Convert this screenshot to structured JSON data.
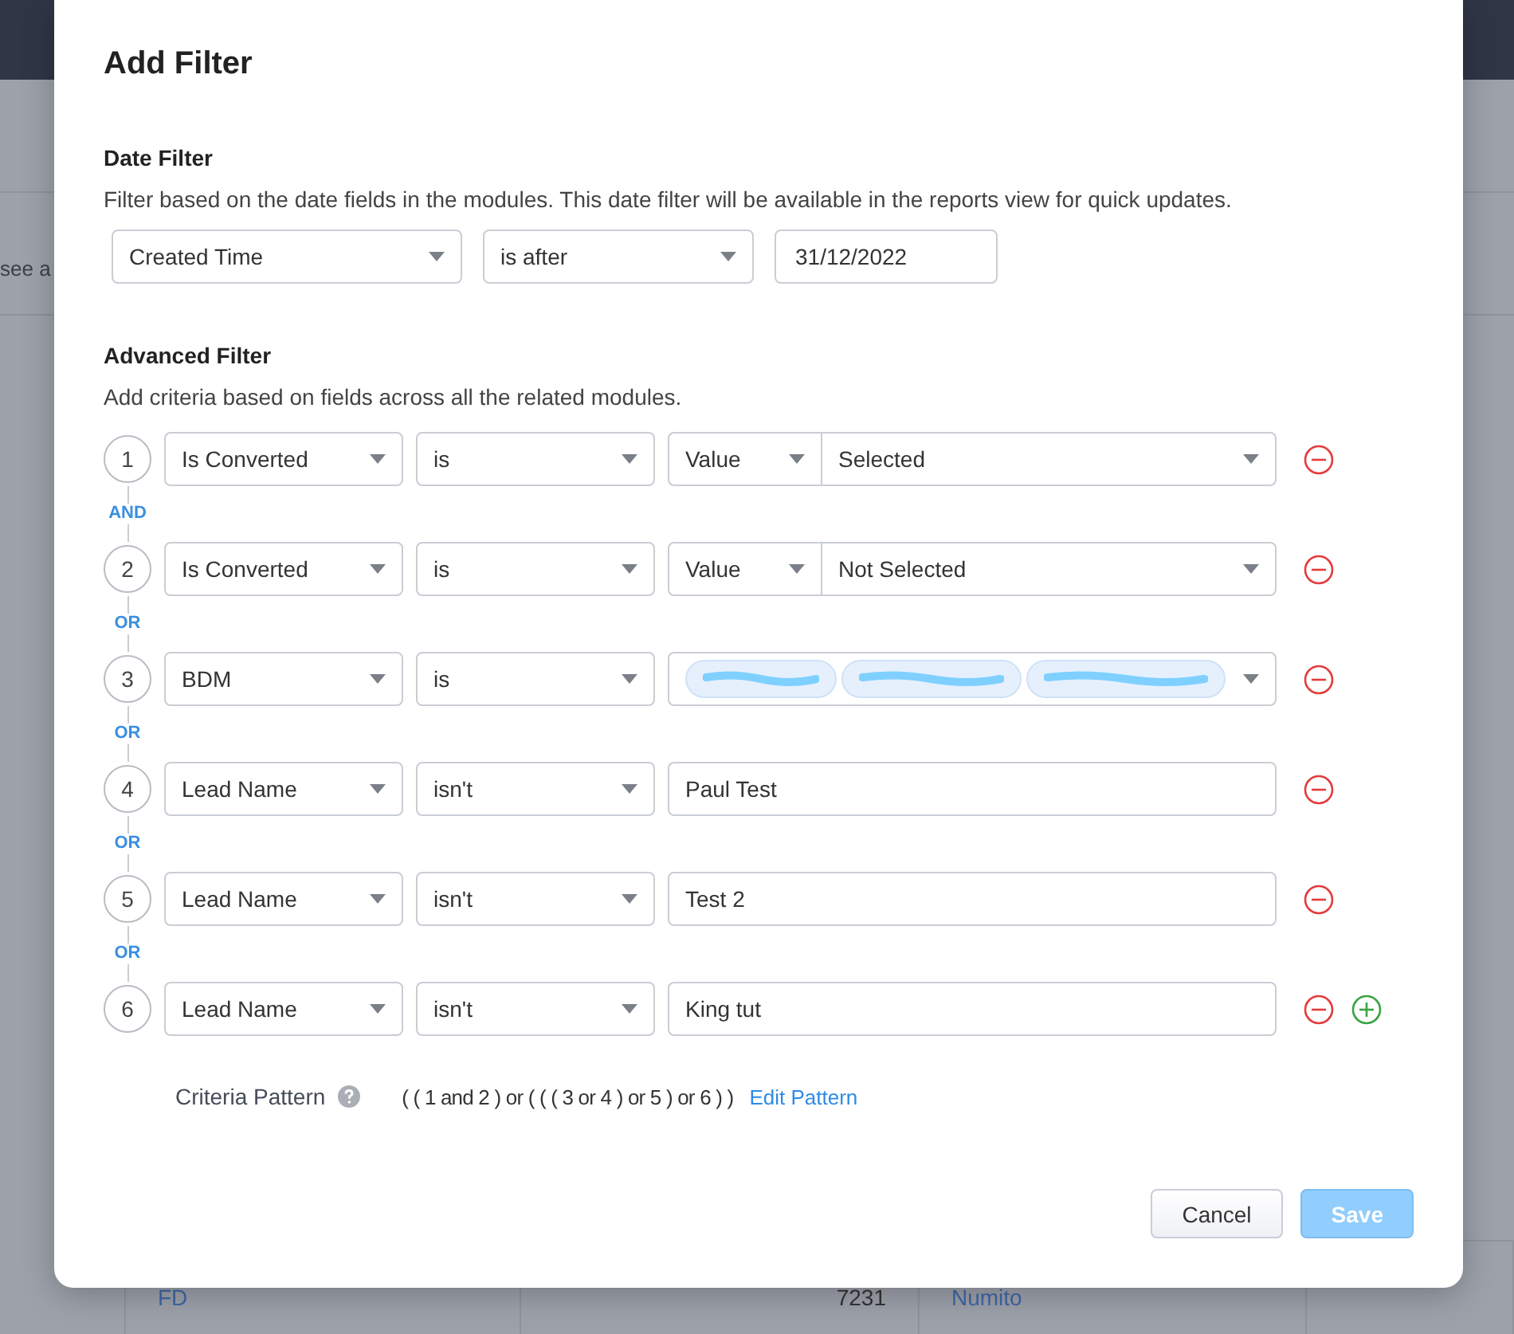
{
  "background": {
    "snippet": "see a",
    "table_cells": [
      "FD",
      "7231",
      "Numito"
    ]
  },
  "dialog": {
    "title": "Add Filter",
    "date_filter": {
      "heading": "Date Filter",
      "description": "Filter based on the date fields in the modules. This date filter will be available in the reports view for quick updates.",
      "field": "Created Time",
      "operator": "is after",
      "date": "31/12/2022"
    },
    "advanced_filter": {
      "heading": "Advanced Filter",
      "description": "Add criteria based on fields across all the related modules.",
      "criteria": [
        {
          "number": "1",
          "field": "Is Converted",
          "operator": "is",
          "value": {
            "kind": "value_select",
            "type": "Value",
            "selection": "Selected"
          },
          "connector": "AND",
          "can_add": false
        },
        {
          "number": "2",
          "field": "Is Converted",
          "operator": "is",
          "value": {
            "kind": "value_select",
            "type": "Value",
            "selection": "Not Selected"
          },
          "connector": "OR",
          "can_add": false
        },
        {
          "number": "3",
          "field": "BDM",
          "operator": "is",
          "value": {
            "kind": "tags",
            "tags": [
              {
                "kind": "redacted"
              },
              {
                "kind": "redacted"
              },
              {
                "kind": "redacted"
              }
            ]
          },
          "connector": "OR",
          "can_add": false
        },
        {
          "number": "4",
          "field": "Lead Name",
          "operator": "isn't",
          "value": {
            "kind": "text",
            "text": "Paul Test"
          },
          "connector": "OR",
          "can_add": false
        },
        {
          "number": "5",
          "field": "Lead Name",
          "operator": "isn't",
          "value": {
            "kind": "text",
            "text": "Test 2"
          },
          "connector": "OR",
          "can_add": false
        },
        {
          "number": "6",
          "field": "Lead Name",
          "operator": "isn't",
          "value": {
            "kind": "text",
            "text": "King tut"
          },
          "can_add": true
        }
      ]
    },
    "criteria_pattern": {
      "label": "Criteria Pattern",
      "pattern": "( ( 1 and 2 ) or ( ( ( 3 or 4 ) or 5 ) or 6 ) )",
      "link": "Edit Pattern"
    },
    "buttons": [
      {
        "label": "Cancel",
        "kind": "secondary",
        "disabled": false
      },
      {
        "label": "Save",
        "kind": "primary",
        "disabled": true
      }
    ]
  }
}
